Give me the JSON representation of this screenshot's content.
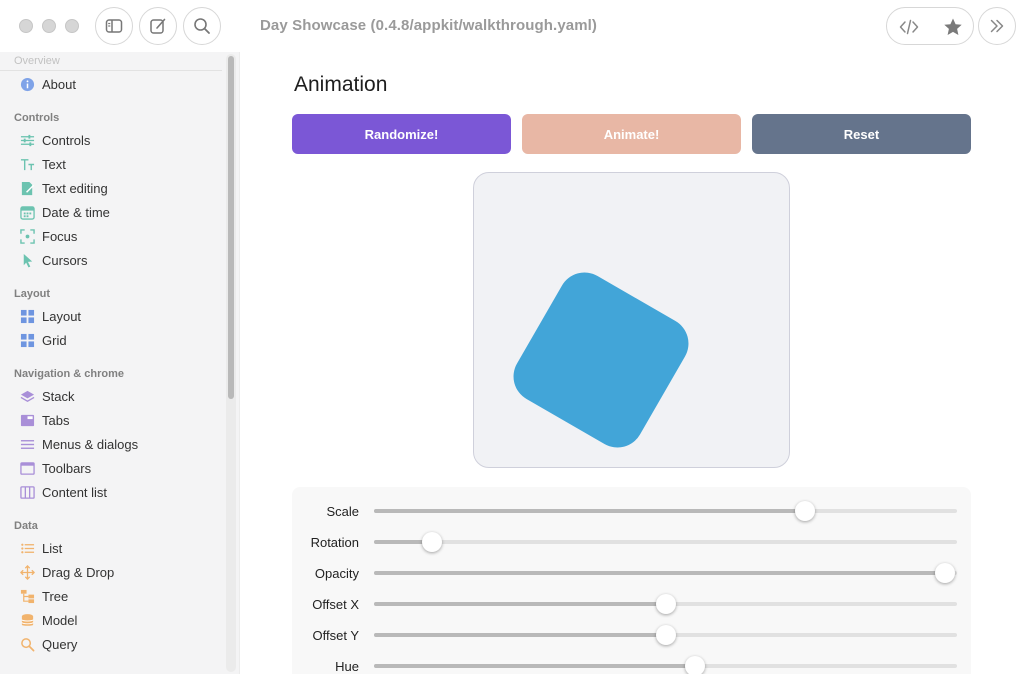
{
  "window": {
    "title": "Day Showcase (0.4.8/appkit/walkthrough.yaml)"
  },
  "toolbar": {
    "sidebar_toggle_icon": "sidebar-icon",
    "compose_icon": "compose-icon",
    "search_icon": "search-icon",
    "code_icon": "code-icon",
    "favorite_icon": "star-icon",
    "forward_icon": "chevron-double-right-icon"
  },
  "sidebar": {
    "faded_header": "Overview",
    "sections": [
      {
        "title": "",
        "items": [
          {
            "label": "About",
            "icon": "info-icon",
            "color": "#7aa0e6"
          }
        ]
      },
      {
        "title": "Controls",
        "items": [
          {
            "label": "Controls",
            "icon": "sliders-icon",
            "color": "#6cc3b0"
          },
          {
            "label": "Text",
            "icon": "text-icon",
            "color": "#6cc3b0"
          },
          {
            "label": "Text editing",
            "icon": "edit-document-icon",
            "color": "#6cc3b0"
          },
          {
            "label": "Date & time",
            "icon": "calendar-icon",
            "color": "#6cc3b0"
          },
          {
            "label": "Focus",
            "icon": "focus-icon",
            "color": "#6cc3b0"
          },
          {
            "label": "Cursors",
            "icon": "cursor-icon",
            "color": "#6cc3b0"
          }
        ]
      },
      {
        "title": "Layout",
        "items": [
          {
            "label": "Layout",
            "icon": "grid-icon",
            "color": "#6e95e0"
          },
          {
            "label": "Grid",
            "icon": "grid-icon",
            "color": "#6e95e0"
          }
        ]
      },
      {
        "title": "Navigation & chrome",
        "items": [
          {
            "label": "Stack",
            "icon": "layers-icon",
            "color": "#a98fd8"
          },
          {
            "label": "Tabs",
            "icon": "tabs-icon",
            "color": "#a98fd8"
          },
          {
            "label": "Menus & dialogs",
            "icon": "menu-icon",
            "color": "#a98fd8"
          },
          {
            "label": "Toolbars",
            "icon": "window-icon",
            "color": "#a98fd8"
          },
          {
            "label": "Content list",
            "icon": "columns-icon",
            "color": "#a98fd8"
          }
        ]
      },
      {
        "title": "Data",
        "items": [
          {
            "label": "List",
            "icon": "list-icon",
            "color": "#f1b36d"
          },
          {
            "label": "Drag & Drop",
            "icon": "move-icon",
            "color": "#f1b36d"
          },
          {
            "label": "Tree",
            "icon": "tree-icon",
            "color": "#f1b36d"
          },
          {
            "label": "Model",
            "icon": "database-icon",
            "color": "#f1b36d"
          },
          {
            "label": "Query",
            "icon": "search-icon",
            "color": "#f1b36d"
          }
        ]
      }
    ]
  },
  "main": {
    "title": "Animation",
    "buttons": [
      {
        "label": "Randomize!",
        "color": "#7b57d6"
      },
      {
        "label": "Animate!",
        "color": "#e8b7a5"
      },
      {
        "label": "Reset",
        "color": "#65748c"
      }
    ],
    "shape_color": "#42a5d8",
    "shape_rotation_deg": 30,
    "sliders": [
      {
        "label": "Scale",
        "value": 0.74
      },
      {
        "label": "Rotation",
        "value": 0.1
      },
      {
        "label": "Opacity",
        "value": 0.98
      },
      {
        "label": "Offset X",
        "value": 0.5
      },
      {
        "label": "Offset Y",
        "value": 0.5
      },
      {
        "label": "Hue",
        "value": 0.55
      }
    ]
  }
}
